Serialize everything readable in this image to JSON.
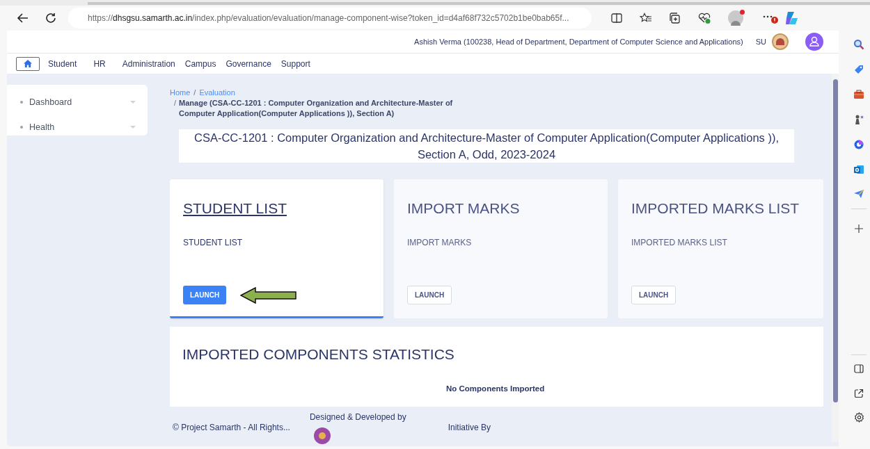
{
  "browser": {
    "url_scheme": "https://",
    "url_host": "dhsgsu.samarth.ac.in",
    "url_path": "/index.php/evaluation/evaluation/manage-component-wise?token_id=d4af68f732c5702b1be0bab65f..."
  },
  "header": {
    "user": "Ashish Verma (100238, Head of Department, Department of Computer Science and Applications)",
    "role": "SU"
  },
  "nav": {
    "items": [
      "Student",
      "HR",
      "Administration",
      "Campus",
      "Governance",
      "Support"
    ]
  },
  "sidebar": {
    "items": [
      {
        "label": "Dashboard"
      },
      {
        "label": "Health"
      }
    ]
  },
  "breadcrumb": {
    "separators": [
      "/",
      "/"
    ],
    "links": [
      "Home",
      "Evaluation"
    ],
    "current": "Manage (CSA-CC-1201 : Computer Organization and Architecture-Master of Computer Application(Computer Applications )), Section A)"
  },
  "course_title": "CSA-CC-1201 : Computer Organization and Architecture-Master of Computer Application(Computer Applications )), Section A, Odd, 2023-2024",
  "cards": [
    {
      "title": "STUDENT LIST",
      "description": "STUDENT LIST",
      "button": "LAUNCH",
      "selected": true
    },
    {
      "title": "IMPORT MARKS",
      "description": "IMPORT MARKS",
      "button": "LAUNCH",
      "selected": false
    },
    {
      "title": "IMPORTED MARKS LIST",
      "description": "IMPORTED MARKS LIST",
      "button": "LAUNCH",
      "selected": false
    }
  ],
  "stats": {
    "title": "IMPORTED COMPONENTS STATISTICS",
    "message": "No Components Imported"
  },
  "footer": {
    "copyright": "© Project Samarth - All Rights...",
    "designed_by": "Designed & Developed by",
    "initiative_by": "Initiative By"
  }
}
